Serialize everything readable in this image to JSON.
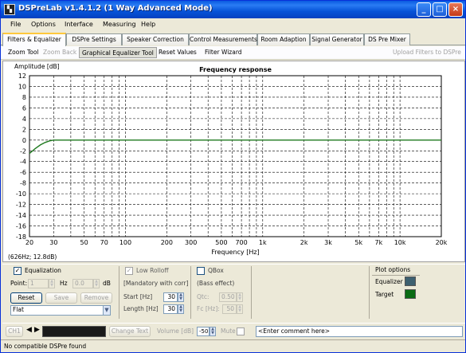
{
  "window": {
    "title": "DSPreLab  v1.4.1.2 (1 Way Advanced Mode)",
    "minimize": "_",
    "maximize": "□",
    "close": "×"
  },
  "menu": [
    "File",
    "Options",
    "Interface",
    "Measuring",
    "Help"
  ],
  "tabs": [
    "Filters & Equalizer",
    "DSPre Settings",
    "Speaker Correction",
    "Control Measurements",
    "Room Adaption",
    "Signal Generator",
    "DS Pre Mixer"
  ],
  "toolbar": {
    "zoom_tool": "Zoom Tool",
    "zoom_back": "Zoom Back",
    "graphical_eq": "Graphical Equalizer Tool",
    "reset_values": "Reset Values",
    "filter_wizard": "Filter Wizard",
    "upload": "Upload Filters to DSPre"
  },
  "chart_data": {
    "type": "line",
    "title": "Frequency response",
    "ylabel": "Amplitude [dB]",
    "xlabel": "Frequency [Hz]",
    "x_scale": "log",
    "xlim": [
      20,
      20000
    ],
    "ylim": [
      -18,
      12
    ],
    "y_ticks": [
      12,
      10,
      8,
      6,
      4,
      2,
      0,
      -2,
      -4,
      -6,
      -8,
      -10,
      -12,
      -14,
      -16,
      -18
    ],
    "x_ticks": [
      20,
      30,
      50,
      70,
      100,
      200,
      300,
      500,
      700,
      1000,
      2000,
      3000,
      5000,
      7000,
      10000,
      20000
    ],
    "x_tick_labels": [
      "20",
      "30",
      "50",
      "70",
      "100",
      "200",
      "300",
      "500",
      "700",
      "1k",
      "2k",
      "3k",
      "5k",
      "7k",
      "10k",
      "20k"
    ],
    "grid": true,
    "cursor_readout": "(626Hz; 12.8dB)",
    "series": [
      {
        "color": "#1f7a1f",
        "x": [
          20,
          22,
          24,
          26,
          28,
          30,
          35,
          40,
          20000
        ],
        "y": [
          -2.5,
          -1.6,
          -0.9,
          -0.45,
          -0.15,
          0,
          0,
          0,
          0
        ]
      }
    ]
  },
  "equalization": {
    "label": "Equalization",
    "checked": "✓",
    "point_label": "Point:",
    "point_value": "1",
    "hz_unit": "Hz",
    "hz_value": "0.0",
    "db_unit": "dB",
    "reset": "Reset",
    "save": "Save",
    "remove": "Remove",
    "preset": "Flat"
  },
  "low_rolloff": {
    "label": "Low Rolloff",
    "checked": "✓",
    "note": "[Mandatory with corr]",
    "start_label": "Start [Hz]",
    "start_value": "30",
    "length_label": "Length [Hz]",
    "length_value": "30"
  },
  "qbox": {
    "label": "QBox",
    "note": "(Bass effect)",
    "qtc_label": "Qtc:",
    "qtc_value": "0.50",
    "fc_label": "Fc [Hz]:",
    "fc_value": "50"
  },
  "plot_options": {
    "title": "Plot options",
    "equalizer": "Equalizer",
    "equalizer_color": "#3d6070",
    "target": "Target",
    "target_color": "#0a6b14"
  },
  "statusline": {
    "channel": "CH1",
    "change_text": "Change Text",
    "volume_label": "Volume [dB]",
    "volume_value": "-50",
    "mute": "Mute",
    "comment": "<Enter comment here>"
  },
  "status": "No compatible DSPre found"
}
